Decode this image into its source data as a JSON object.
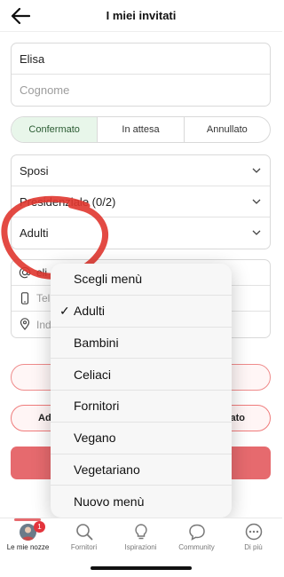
{
  "header": {
    "title": "I miei invitati"
  },
  "name_group": {
    "first_name": "Elisa",
    "last_name_placeholder": "Cognome"
  },
  "status_segments": [
    {
      "label": "Confermato",
      "selected": true
    },
    {
      "label": "In attesa",
      "selected": false
    },
    {
      "label": "Annullato",
      "selected": false
    }
  ],
  "selects": {
    "group": "Sposi",
    "table": "Presidenziale (0/2)",
    "menu": "Adulti"
  },
  "contact": {
    "email_value": "eli",
    "phone_placeholder": "Tel",
    "address_placeholder": "Ind"
  },
  "buttons": {
    "left_label": "Ad",
    "right_label": "ato"
  },
  "dropdown": {
    "items": [
      {
        "label": "Scegli menù",
        "checked": false
      },
      {
        "label": "Adulti",
        "checked": true
      },
      {
        "label": "Bambini",
        "checked": false
      },
      {
        "label": "Celiaci",
        "checked": false
      },
      {
        "label": "Fornitori",
        "checked": false
      },
      {
        "label": "Vegano",
        "checked": false
      },
      {
        "label": "Vegetariano",
        "checked": false
      },
      {
        "label": "Nuovo menù",
        "checked": false
      }
    ],
    "check_glyph": "✓"
  },
  "tabbar": {
    "tabs": [
      {
        "label": "Le mie nozze",
        "icon": "avatar-icon",
        "active": true,
        "badge": "1"
      },
      {
        "label": "Fornitori",
        "icon": "search-icon",
        "active": false
      },
      {
        "label": "Ispirazioni",
        "icon": "lightbulb-icon",
        "active": false
      },
      {
        "label": "Community",
        "icon": "chat-bubble-icon",
        "active": false
      },
      {
        "label": "Di più",
        "icon": "more-icon",
        "active": false
      }
    ]
  },
  "colors": {
    "accent": "#e66a6e",
    "confirmed_bg": "#e8f6ea",
    "scribble": "#e0362f"
  }
}
